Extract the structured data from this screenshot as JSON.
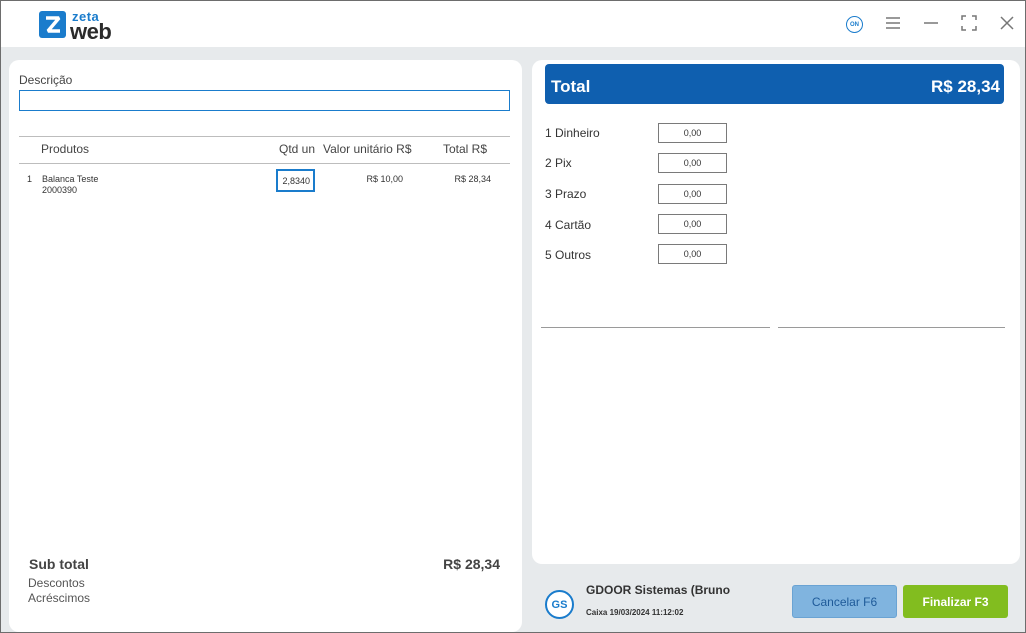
{
  "app": {
    "logo_zeta": "zeta",
    "logo_web": "web",
    "status_badge": "ON",
    "accent_color": "#1a7ccc",
    "total_bar_color": "#0f5faf"
  },
  "window_controls": {
    "menu_icon": "hamburger-menu-icon",
    "minimize_icon": "minimize-icon",
    "maximize_icon": "fullscreen-icon",
    "close_icon": "close-icon"
  },
  "sale": {
    "description_label": "Descrição",
    "description_value": "",
    "columns": {
      "produtos": "Produtos",
      "qtd": "Qtd un",
      "valor_unitario": "Valor unitário R$",
      "total": "Total R$"
    },
    "items": [
      {
        "index": "1",
        "name": "Balanca Teste",
        "code": "2000390",
        "qtd": "2,8340",
        "valor_unitario": "R$ 10,00",
        "total": "R$ 28,34"
      }
    ],
    "subtotal_label": "Sub total",
    "subtotal_value": "R$ 28,34",
    "descontos_label": "Descontos",
    "acrescimos_label": "Acréscimos"
  },
  "payment": {
    "total_label": "Total",
    "total_value": "R$ 28,34",
    "methods": [
      {
        "label": "1 Dinheiro",
        "value": "0,00"
      },
      {
        "label": "2 Pix",
        "value": "0,00"
      },
      {
        "label": "3 Prazo",
        "value": "0,00"
      },
      {
        "label": "4 Cartão",
        "value": "0,00"
      },
      {
        "label": "5 Outros",
        "value": "0,00"
      }
    ]
  },
  "footer": {
    "avatar_initials": "GS",
    "user_name": "GDOOR Sistemas (Bruno E",
    "caixa": "Caixa 19/03/2024 11:12:02",
    "cancel_label": "Cancelar F6",
    "finalize_label": "Finalizar F3"
  }
}
